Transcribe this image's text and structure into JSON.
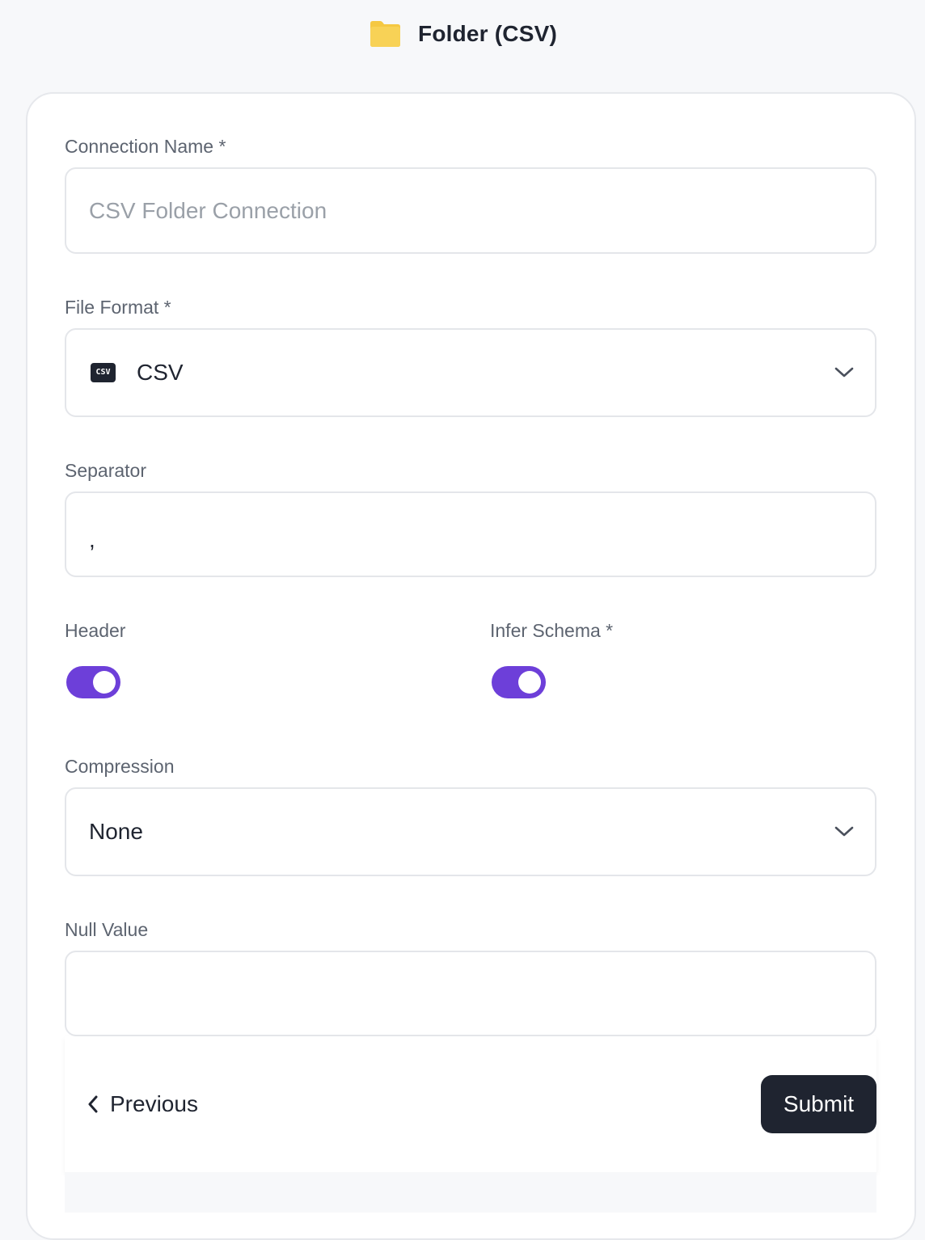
{
  "header": {
    "icon": "folder-icon",
    "title": "Folder (CSV)",
    "icon_color": "#f5c842"
  },
  "form": {
    "connection_name": {
      "label": "Connection Name *",
      "placeholder": "CSV Folder Connection",
      "value": ""
    },
    "file_format": {
      "label": "File Format *",
      "icon": "csv-file-icon",
      "icon_text": "CSV",
      "value": "CSV"
    },
    "separator": {
      "label": "Separator",
      "value": ","
    },
    "header_toggle": {
      "label": "Header",
      "on": true
    },
    "infer_schema_toggle": {
      "label": "Infer Schema *",
      "on": true
    },
    "compression": {
      "label": "Compression",
      "value": "None"
    },
    "null_value": {
      "label": "Null Value",
      "value": ""
    }
  },
  "footer": {
    "previous_label": "Previous",
    "submit_label": "Submit"
  },
  "colors": {
    "accent": "#6d3fd9",
    "dark": "#1f2430",
    "background": "#f7f8fa"
  }
}
